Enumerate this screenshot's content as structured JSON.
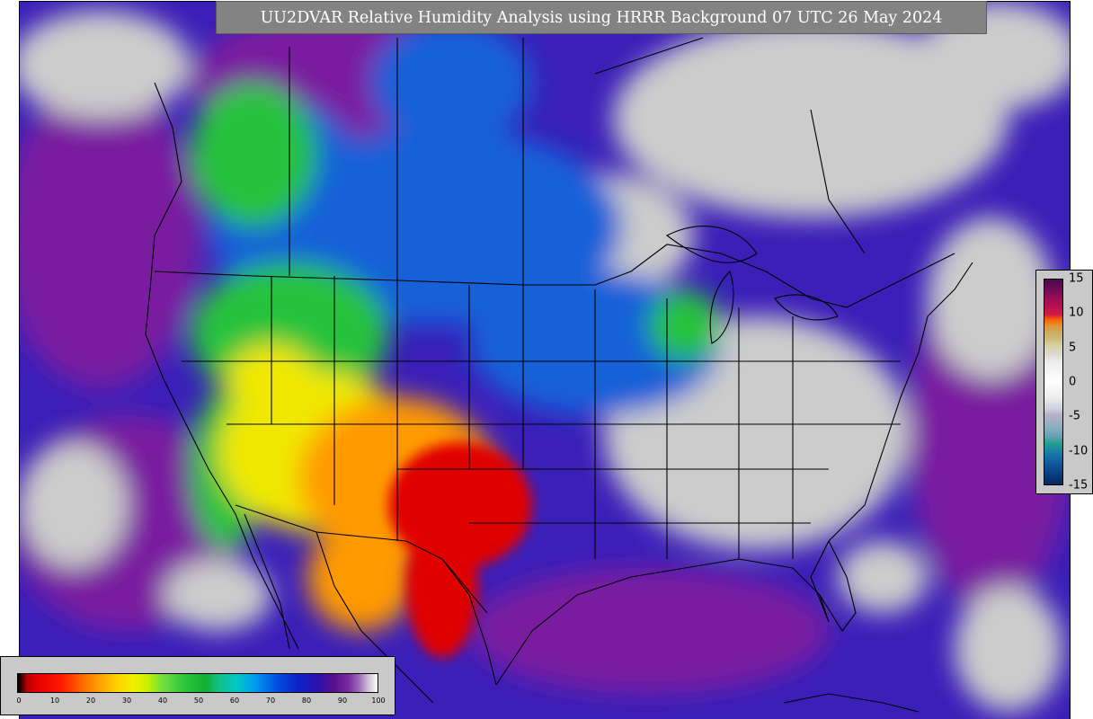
{
  "title": "UU2DVAR Relative Humidity Analysis using HRRR Background 07 UTC 26 May 2024",
  "map_colors": {
    "ocean": "#3a1fb8",
    "land_mid": "#1560d8",
    "dry": "#e00000",
    "orange": "#ff9a00",
    "yellow": "#f0e800",
    "green": "#28c23c",
    "purple": "#7a1aa0",
    "saturated": "#cccccc",
    "borders": "#000000"
  },
  "rh_colorbar": {
    "ticks": [
      "0",
      "10",
      "20",
      "30",
      "40",
      "50",
      "60",
      "70",
      "80",
      "90",
      "100"
    ],
    "gradient": "linear-gradient(to right, #000000 0%, #3a0000 1%, #b80000 2.5%, #e00000 5%, #ff1a00 12%, #ff6a00 18%, #ff9a00 22%, #ffcc00 27%, #f2f000 32%, #c8f000 36%, #74e040 40%, #2cc83c 46%, #12b030 52%, #10c088 56%, #00c8c8 61%, #0098f0 66%, #0050e0 72%, #1020c8 78%, #3010a8 84%, #5a108c 88%, #7a2aa0 92%, #a070b8 95%, #cfc0d8 97.5%, #ffffff 100%)"
  },
  "diff_colorbar": {
    "ticks": [
      "15",
      "10",
      "5",
      "0",
      "-5",
      "-10",
      "-15"
    ],
    "gradient": "linear-gradient(to bottom, #4a0a4a 0%, #7a0a5a 6%, #b01050 12%, #d01848 17%, #ff6a00 20%, #d89a40 23%, #c8b870 28%, #d8cfa0 32%, #dcd8d0 36%, #ececec 40%, #ffffff 50%, #ececec 58%, #d0d0e0 63%, #b8b0c8 66%, #8ab0c0 72%, #60a0b0 77%, #20a090 80%, #1878a8 85%, #1058a0 90%, #083878 96%, #082858 100%)"
  }
}
